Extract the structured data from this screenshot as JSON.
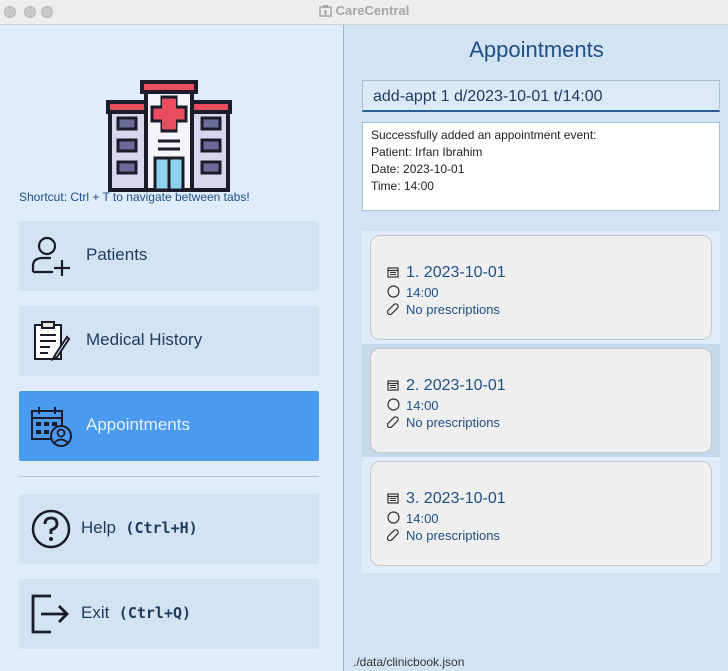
{
  "window": {
    "title": "CareCentral"
  },
  "sidebar": {
    "shortcut_hint": "Shortcut: Ctrl + T to navigate between tabs!",
    "nav": [
      {
        "label": "Patients",
        "icon": "patient-add-icon",
        "active": false
      },
      {
        "label": "Medical History",
        "icon": "clipboard-icon",
        "active": false
      },
      {
        "label": "Appointments",
        "icon": "calendar-doctor-icon",
        "active": true
      }
    ],
    "help": {
      "label": "Help",
      "shortcut": "(Ctrl+H)",
      "icon": "question-icon"
    },
    "exit": {
      "label": "Exit",
      "shortcut": "(Ctrl+Q)",
      "icon": "exit-icon"
    }
  },
  "main": {
    "heading": "Appointments",
    "command": "add-appt 1 d/2023-10-01 t/14:00",
    "result_lines": [
      "Successfully added an appointment event:",
      "Patient: Irfan Ibrahim",
      "Date: 2023-10-01",
      "Time: 14:00"
    ],
    "appointments": [
      {
        "title": "1. 2023-10-01",
        "time": "14:00",
        "prescriptions": "No prescriptions"
      },
      {
        "title": "2. 2023-10-01",
        "time": "14:00",
        "prescriptions": "No prescriptions"
      },
      {
        "title": "3. 2023-10-01",
        "time": "14:00",
        "prescriptions": "No prescriptions"
      }
    ],
    "selected_index": 1
  },
  "footer": {
    "path": "./data/clinicbook.json"
  },
  "colors": {
    "accent": "#4a9af0",
    "text_primary": "#1f4f86",
    "panel": "#d2e3f4"
  }
}
